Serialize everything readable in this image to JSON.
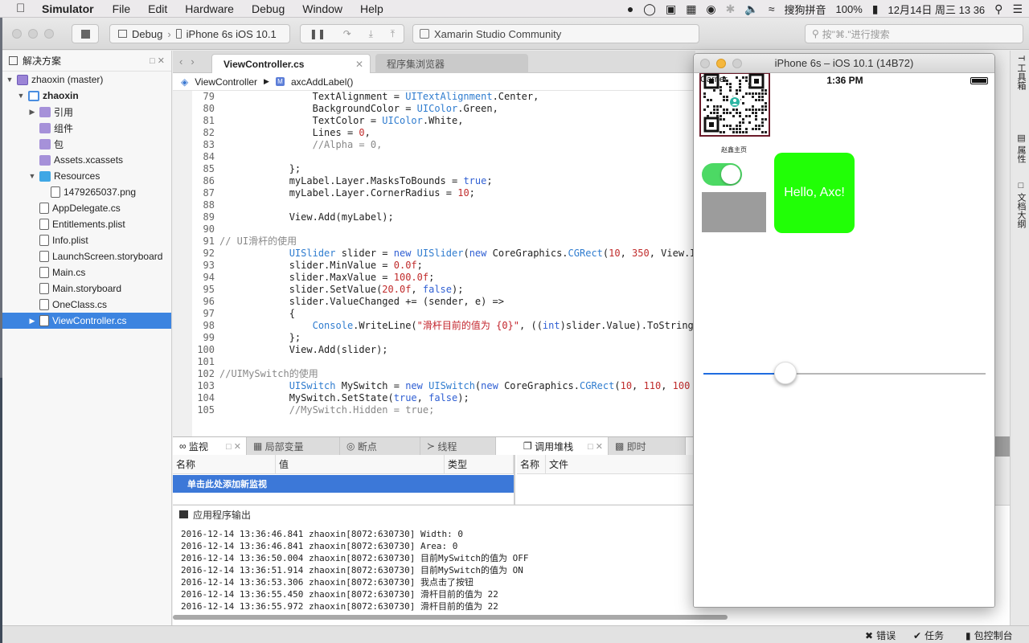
{
  "menubar": {
    "apple": "",
    "app": "Simulator",
    "items": [
      "File",
      "Edit",
      "Hardware",
      "Debug",
      "Window",
      "Help"
    ],
    "input_method": "搜狗拼音",
    "battery": "100%",
    "clock": "12月14日 周三 13 36"
  },
  "toolbar": {
    "config": "Debug",
    "device": "iPhone 6s iOS 10.1",
    "status": "Xamarin Studio Community",
    "search_placeholder": "按\"⌘.\"进行搜索"
  },
  "solution": {
    "title": "解决方案",
    "items": [
      {
        "label": "zhaoxin (master)",
        "icon": "sln",
        "indent": 0,
        "arrow": "▼"
      },
      {
        "label": "zhaoxin",
        "icon": "proj",
        "indent": 1,
        "arrow": "▼",
        "bold": true
      },
      {
        "label": "引用",
        "icon": "purple",
        "indent": 2,
        "arrow": "▶"
      },
      {
        "label": "组件",
        "icon": "purple",
        "indent": 2,
        "arrow": ""
      },
      {
        "label": "包",
        "icon": "purple",
        "indent": 2,
        "arrow": ""
      },
      {
        "label": "Assets.xcassets",
        "icon": "purple",
        "indent": 2,
        "arrow": ""
      },
      {
        "label": "Resources",
        "icon": "blue",
        "indent": 2,
        "arrow": "▼"
      },
      {
        "label": "1479265037.png",
        "icon": "doc",
        "indent": 3,
        "arrow": ""
      },
      {
        "label": "AppDelegate.cs",
        "icon": "doc",
        "indent": 2,
        "arrow": ""
      },
      {
        "label": "Entitlements.plist",
        "icon": "doc",
        "indent": 2,
        "arrow": ""
      },
      {
        "label": "Info.plist",
        "icon": "doc",
        "indent": 2,
        "arrow": ""
      },
      {
        "label": "LaunchScreen.storyboard",
        "icon": "doc",
        "indent": 2,
        "arrow": ""
      },
      {
        "label": "Main.cs",
        "icon": "doc",
        "indent": 2,
        "arrow": ""
      },
      {
        "label": "Main.storyboard",
        "icon": "doc",
        "indent": 2,
        "arrow": ""
      },
      {
        "label": "OneClass.cs",
        "icon": "doc",
        "indent": 2,
        "arrow": ""
      },
      {
        "label": "ViewController.cs",
        "icon": "doc",
        "indent": 2,
        "arrow": "▶",
        "selected": true
      }
    ]
  },
  "editor": {
    "active_tab": "ViewController.cs",
    "inactive_tab": "程序集浏览器",
    "crumb_class": "ViewController",
    "crumb_method": "axcAddLabel()",
    "lines": [
      [
        {
          "t": "79",
          "c": "ln"
        },
        {
          "t": "                TextAlignment = ",
          "c": "txt"
        },
        {
          "t": "UITextAlignment",
          "c": "ty"
        },
        {
          "t": ".Center,",
          "c": "txt"
        }
      ],
      [
        {
          "t": "80",
          "c": "ln"
        },
        {
          "t": "                BackgroundColor = ",
          "c": "txt"
        },
        {
          "t": "UIColor",
          "c": "ty"
        },
        {
          "t": ".Green,",
          "c": "txt"
        }
      ],
      [
        {
          "t": "81",
          "c": "ln"
        },
        {
          "t": "                TextColor = ",
          "c": "txt"
        },
        {
          "t": "UIColor",
          "c": "ty"
        },
        {
          "t": ".White,",
          "c": "txt"
        }
      ],
      [
        {
          "t": "82",
          "c": "ln"
        },
        {
          "t": "                Lines = ",
          "c": "txt"
        },
        {
          "t": "0",
          "c": "num"
        },
        {
          "t": ",",
          "c": "txt"
        }
      ],
      [
        {
          "t": "83",
          "c": "ln"
        },
        {
          "t": "                //Alpha = 0,",
          "c": "cm"
        }
      ],
      [
        {
          "t": "84",
          "c": "ln"
        }
      ],
      [
        {
          "t": "85",
          "c": "ln"
        },
        {
          "t": "            };",
          "c": "txt"
        }
      ],
      [
        {
          "t": "86",
          "c": "ln"
        },
        {
          "t": "            myLabel.Layer.MasksToBounds = ",
          "c": "txt"
        },
        {
          "t": "true",
          "c": "kw"
        },
        {
          "t": ";",
          "c": "txt"
        }
      ],
      [
        {
          "t": "87",
          "c": "ln"
        },
        {
          "t": "            myLabel.Layer.CornerRadius = ",
          "c": "txt"
        },
        {
          "t": "10",
          "c": "num"
        },
        {
          "t": ";",
          "c": "txt"
        }
      ],
      [
        {
          "t": "88",
          "c": "ln"
        }
      ],
      [
        {
          "t": "89",
          "c": "ln"
        },
        {
          "t": "            View.Add(myLabel);",
          "c": "txt"
        }
      ],
      [
        {
          "t": "90",
          "c": "ln"
        }
      ],
      [
        {
          "t": "91",
          "c": "ln"
        },
        {
          "t": "// UI滑杆的使用",
          "c": "cm"
        }
      ],
      [
        {
          "t": "92",
          "c": "ln"
        },
        {
          "t": "            ",
          "c": "txt"
        },
        {
          "t": "UISlider",
          "c": "ty"
        },
        {
          "t": " slider = ",
          "c": "txt"
        },
        {
          "t": "new",
          "c": "kw"
        },
        {
          "t": " ",
          "c": "txt"
        },
        {
          "t": "UISlider",
          "c": "ty"
        },
        {
          "t": "(",
          "c": "txt"
        },
        {
          "t": "new",
          "c": "kw"
        },
        {
          "t": " CoreGraphics.",
          "c": "txt"
        },
        {
          "t": "CGRect",
          "c": "ty"
        },
        {
          "t": "(",
          "c": "txt"
        },
        {
          "t": "10",
          "c": "num"
        },
        {
          "t": ", ",
          "c": "txt"
        },
        {
          "t": "350",
          "c": "num"
        },
        {
          "t": ", View.I",
          "c": "txt"
        }
      ],
      [
        {
          "t": "93",
          "c": "ln"
        },
        {
          "t": "            slider.MinValue = ",
          "c": "txt"
        },
        {
          "t": "0.0f",
          "c": "num"
        },
        {
          "t": ";",
          "c": "txt"
        }
      ],
      [
        {
          "t": "94",
          "c": "ln"
        },
        {
          "t": "            slider.MaxValue = ",
          "c": "txt"
        },
        {
          "t": "100.0f",
          "c": "num"
        },
        {
          "t": ";",
          "c": "txt"
        }
      ],
      [
        {
          "t": "95",
          "c": "ln"
        },
        {
          "t": "            slider.SetValue(",
          "c": "txt"
        },
        {
          "t": "20.0f",
          "c": "num"
        },
        {
          "t": ", ",
          "c": "txt"
        },
        {
          "t": "false",
          "c": "kw"
        },
        {
          "t": ");",
          "c": "txt"
        }
      ],
      [
        {
          "t": "96",
          "c": "ln"
        },
        {
          "t": "            slider.ValueChanged += (sender, e) =>",
          "c": "txt"
        }
      ],
      [
        {
          "t": "97",
          "c": "ln"
        },
        {
          "t": "            {",
          "c": "txt"
        }
      ],
      [
        {
          "t": "98",
          "c": "ln"
        },
        {
          "t": "                Console",
          "c": "ty"
        },
        {
          "t": ".WriteLine(",
          "c": "txt"
        },
        {
          "t": "\"滑杆目前的值为 {0}\"",
          "c": "str"
        },
        {
          "t": ", ((",
          "c": "txt"
        },
        {
          "t": "int",
          "c": "kw"
        },
        {
          "t": ")slider.Value).ToString",
          "c": "txt"
        }
      ],
      [
        {
          "t": "99",
          "c": "ln"
        },
        {
          "t": "            };",
          "c": "txt"
        }
      ],
      [
        {
          "t": "100",
          "c": "ln"
        },
        {
          "t": "            View.Add(slider);",
          "c": "txt"
        }
      ],
      [
        {
          "t": "101",
          "c": "ln"
        }
      ],
      [
        {
          "t": "102",
          "c": "ln"
        },
        {
          "t": "//UIMySwitch的使用",
          "c": "cm"
        }
      ],
      [
        {
          "t": "103",
          "c": "ln"
        },
        {
          "t": "            ",
          "c": "txt"
        },
        {
          "t": "UISwitch",
          "c": "ty"
        },
        {
          "t": " MySwitch = ",
          "c": "txt"
        },
        {
          "t": "new",
          "c": "kw"
        },
        {
          "t": " ",
          "c": "txt"
        },
        {
          "t": "UISwitch",
          "c": "ty"
        },
        {
          "t": "(",
          "c": "txt"
        },
        {
          "t": "new",
          "c": "kw"
        },
        {
          "t": " CoreGraphics.",
          "c": "txt"
        },
        {
          "t": "CGRect",
          "c": "ty"
        },
        {
          "t": "(",
          "c": "txt"
        },
        {
          "t": "10",
          "c": "num"
        },
        {
          "t": ", ",
          "c": "txt"
        },
        {
          "t": "110",
          "c": "num"
        },
        {
          "t": ", ",
          "c": "txt"
        },
        {
          "t": "100",
          "c": "num"
        }
      ],
      [
        {
          "t": "104",
          "c": "ln"
        },
        {
          "t": "            MySwitch.SetState(",
          "c": "txt"
        },
        {
          "t": "true",
          "c": "kw"
        },
        {
          "t": ", ",
          "c": "txt"
        },
        {
          "t": "false",
          "c": "kw"
        },
        {
          "t": ");",
          "c": "txt"
        }
      ],
      [
        {
          "t": "105",
          "c": "ln"
        },
        {
          "t": "            //MySwitch.Hidden = true;",
          "c": "cm"
        }
      ]
    ]
  },
  "watch_panel": {
    "tabs": [
      "监视",
      "局部变量",
      "断点",
      "线程"
    ],
    "columns": [
      "名称",
      "值",
      "类型"
    ],
    "add_watch": "单击此处添加新监视"
  },
  "callstack_panel": {
    "tabs": [
      "调用堆栈",
      "即时"
    ],
    "columns": [
      "名称",
      "文件"
    ]
  },
  "output": {
    "title": "应用程序输出",
    "lines": [
      "2016-12-14 13:36:46.841 zhaoxin[8072:630730] Width: 0",
      "2016-12-14 13:36:46.841 zhaoxin[8072:630730] Area: 0",
      "2016-12-14 13:36:50.004 zhaoxin[8072:630730] 目前MySwitch的值为 OFF",
      "2016-12-14 13:36:51.914 zhaoxin[8072:630730] 目前MySwitch的值为 ON",
      "2016-12-14 13:36:53.306 zhaoxin[8072:630730] 我点击了按钮",
      "2016-12-14 13:36:55.450 zhaoxin[8072:630730] 滑杆目前的值为 22",
      "2016-12-14 13:36:55.972 zhaoxin[8072:630730] 滑杆目前的值为 22"
    ]
  },
  "statusbar": {
    "errors": "错误",
    "tasks": "任务",
    "console": "包控制台"
  },
  "right_pads": [
    "工具箱",
    "属性",
    "文档大纲"
  ],
  "simulator": {
    "title": "iPhone 6s – iOS 10.1 (14B72)",
    "carrier": "Carrier",
    "time": "1:36 PM",
    "qr_caption": "赵鑫主页",
    "label_text": "Hello, Axc!",
    "slider_value": 0.25,
    "switch_on": true
  },
  "colors": {
    "selection": "#3c84e0",
    "green_label": "#21ff06",
    "switch_on": "#4cd964",
    "slider_fill": "#1f6ce0"
  }
}
